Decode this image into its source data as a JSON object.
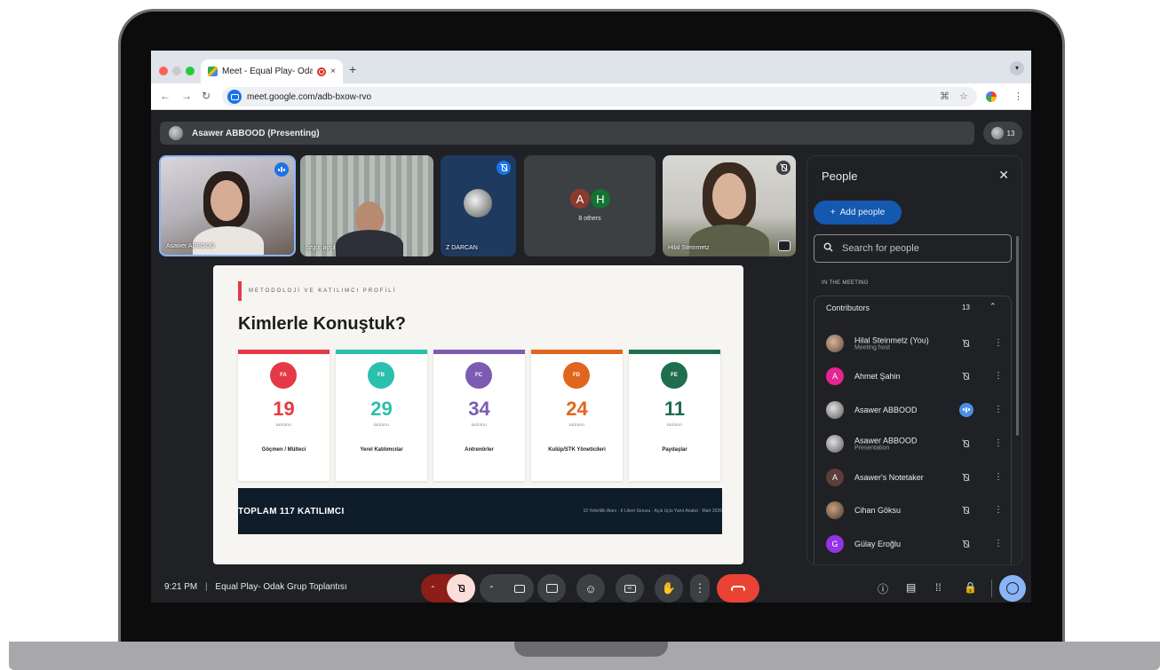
{
  "browser": {
    "tab_title": "Meet - Equal Play- Odak G",
    "tab_close": "×",
    "new_tab": "+",
    "url": "meet.google.com/adb-bxow-rvo"
  },
  "meet": {
    "presenter_label": "Asawer ABBOOD (Presenting)",
    "participant_count": "13",
    "tiles": [
      {
        "name": "Asawer ABBOOD"
      },
      {
        "name": "özgür aycil"
      },
      {
        "name": "Z DARCAN"
      },
      {
        "name": "8 others",
        "initials": [
          "A",
          "H"
        ]
      },
      {
        "name": "Hilal Steinmetz"
      }
    ],
    "time": "9:21 PM",
    "separator": "|",
    "meeting_name": "Equal Play- Odak Grup Toplantısı"
  },
  "slide": {
    "kicker": "METODOLOJİ VE KATILIMCI PROFİLİ",
    "title": "Kimlerle Konuştuk?",
    "cards": [
      {
        "badge": "FA",
        "number": "19",
        "unit": "katılımcı",
        "label": "Göçmen / Mülteci",
        "color": "#e53945"
      },
      {
        "badge": "FB",
        "number": "29",
        "unit": "katılımcı",
        "label": "Yerel Katılımcılar",
        "color": "#2bbfae"
      },
      {
        "badge": "FC",
        "number": "34",
        "unit": "katılımcı",
        "label": "Antrenörler",
        "color": "#7c5bb3"
      },
      {
        "badge": "FD",
        "number": "24",
        "unit": "katılımcı",
        "label": "Kulüp/STK Yöneticileri",
        "color": "#e0661d"
      },
      {
        "badge": "FE",
        "number": "11",
        "unit": "katılımcı",
        "label": "Paydaşlar",
        "color": "#1f6e4e"
      }
    ],
    "total": "TOPLAM  117  KATILIMCI",
    "footer_note": "10 Yeterlilik Alanı · 6 Likert Sorusu · Açık Uçlu Yanıt Analizi · Mart 2026"
  },
  "people_panel": {
    "title": "People",
    "add_people": "Add people",
    "search_placeholder": "Search for people",
    "section_label": "IN THE MEETING",
    "group_label": "Contributors",
    "group_count": "13",
    "people": [
      {
        "name": "Hilal Steinmetz (You)",
        "sub": "Meeting host",
        "initial": "",
        "color": "#8a6b5c"
      },
      {
        "name": "Ahmet Şahin",
        "sub": "",
        "initial": "A",
        "color": "#e52592"
      },
      {
        "name": "Asawer ABBOOD",
        "sub": "",
        "initial": "",
        "color": "#7d7d7d"
      },
      {
        "name": "Asawer ABBOOD",
        "sub": "Presentation",
        "initial": "",
        "color": "#7d7d7d"
      },
      {
        "name": "Asawer's Notetaker",
        "sub": "",
        "initial": "A",
        "color": "#5c3d3a"
      },
      {
        "name": "Cihan Göksu",
        "sub": "",
        "initial": "",
        "color": "#6b5546"
      },
      {
        "name": "Gülay Eroğlu",
        "sub": "",
        "initial": "G",
        "color": "#9334e6"
      }
    ]
  },
  "colors": {
    "accent": "#1a73e8",
    "end_call": "#ea4335",
    "mic_off": "#8c1d18"
  }
}
